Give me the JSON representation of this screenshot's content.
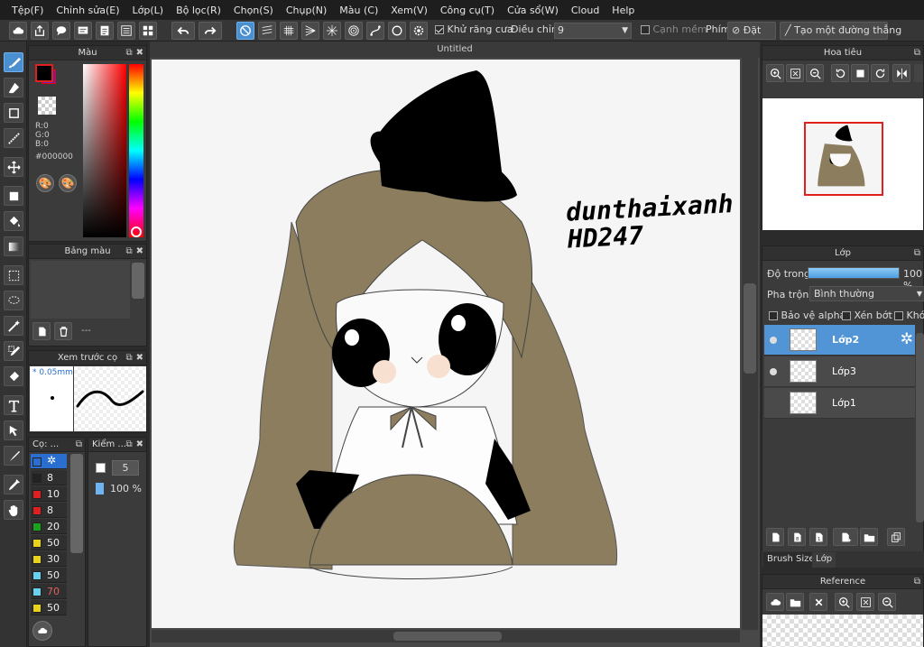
{
  "menu": [
    "Tệp(F)",
    "Chỉnh sửa(E)",
    "Lớp(L)",
    "Bộ lọc(R)",
    "Chọn(S)",
    "Chụp(N)",
    "Màu (C)",
    "Xem(V)",
    "Công cụ(T)",
    "Cửa sổ(W)",
    "Cloud",
    "Help"
  ],
  "toolbar": {
    "antialias_label": "Khử răng cưa",
    "antialias_checked": true,
    "adjust_label": "Điều chỉnh",
    "adjust_value": "9",
    "edge_label": "Cạnh mềm",
    "key_label": "Phím",
    "reset_label": "Đặt lại",
    "straight_label": "Tạo một đường thẳng"
  },
  "color_panel": {
    "title": "Màu",
    "r": "R:0",
    "g": "G:0",
    "b": "B:0",
    "hex": "#000000",
    "fg": "#000000",
    "bg": "#6a1fb0"
  },
  "palette_panel": {
    "title": "Bảng màu",
    "dash": "---"
  },
  "brush_preview": {
    "title": "Xem trước cọ",
    "size": "* 0.05mm"
  },
  "brush_list": {
    "title": "Cọ: ...",
    "items": [
      {
        "color": "#2a6fd0",
        "value": ""
      },
      {
        "color": "#222222",
        "value": "8"
      },
      {
        "color": "#e02020",
        "value": "10"
      },
      {
        "color": "#e02020",
        "value": "8"
      },
      {
        "color": "#1aa31a",
        "value": "20"
      },
      {
        "color": "#e8d21a",
        "value": "50"
      },
      {
        "color": "#e8d21a",
        "value": "30"
      },
      {
        "color": "#6ad0f0",
        "value": "50"
      },
      {
        "color": "#6ad0f0",
        "value": "70"
      },
      {
        "color": "#e8d21a",
        "value": "50"
      }
    ]
  },
  "brush_control": {
    "title": "Kiểm ...",
    "size": "5",
    "opacity": "100 %"
  },
  "canvas": {
    "title": "Untitled",
    "signature": "dunthaixanh HD247"
  },
  "navigator": {
    "title": "Hoa tiêu"
  },
  "layers_panel": {
    "title": "Lớp",
    "opacity_label": "Độ trong",
    "opacity_value": "100 %",
    "opacity": 1.0,
    "blend_label": "Pha trộn",
    "blend_value": "Bình thường",
    "protect_alpha": "Bảo vệ alpha",
    "clipping": "Xén bớt",
    "lock": "Khóa",
    "layers": [
      {
        "name": "Lớp2",
        "selected": true,
        "visible": true
      },
      {
        "name": "Lớp3",
        "selected": false,
        "visible": true
      },
      {
        "name": "Lớp1",
        "selected": false,
        "visible": false
      }
    ]
  },
  "bottom_tabs": [
    "Brush Size",
    "Lớp"
  ],
  "reference": {
    "title": "Reference"
  }
}
